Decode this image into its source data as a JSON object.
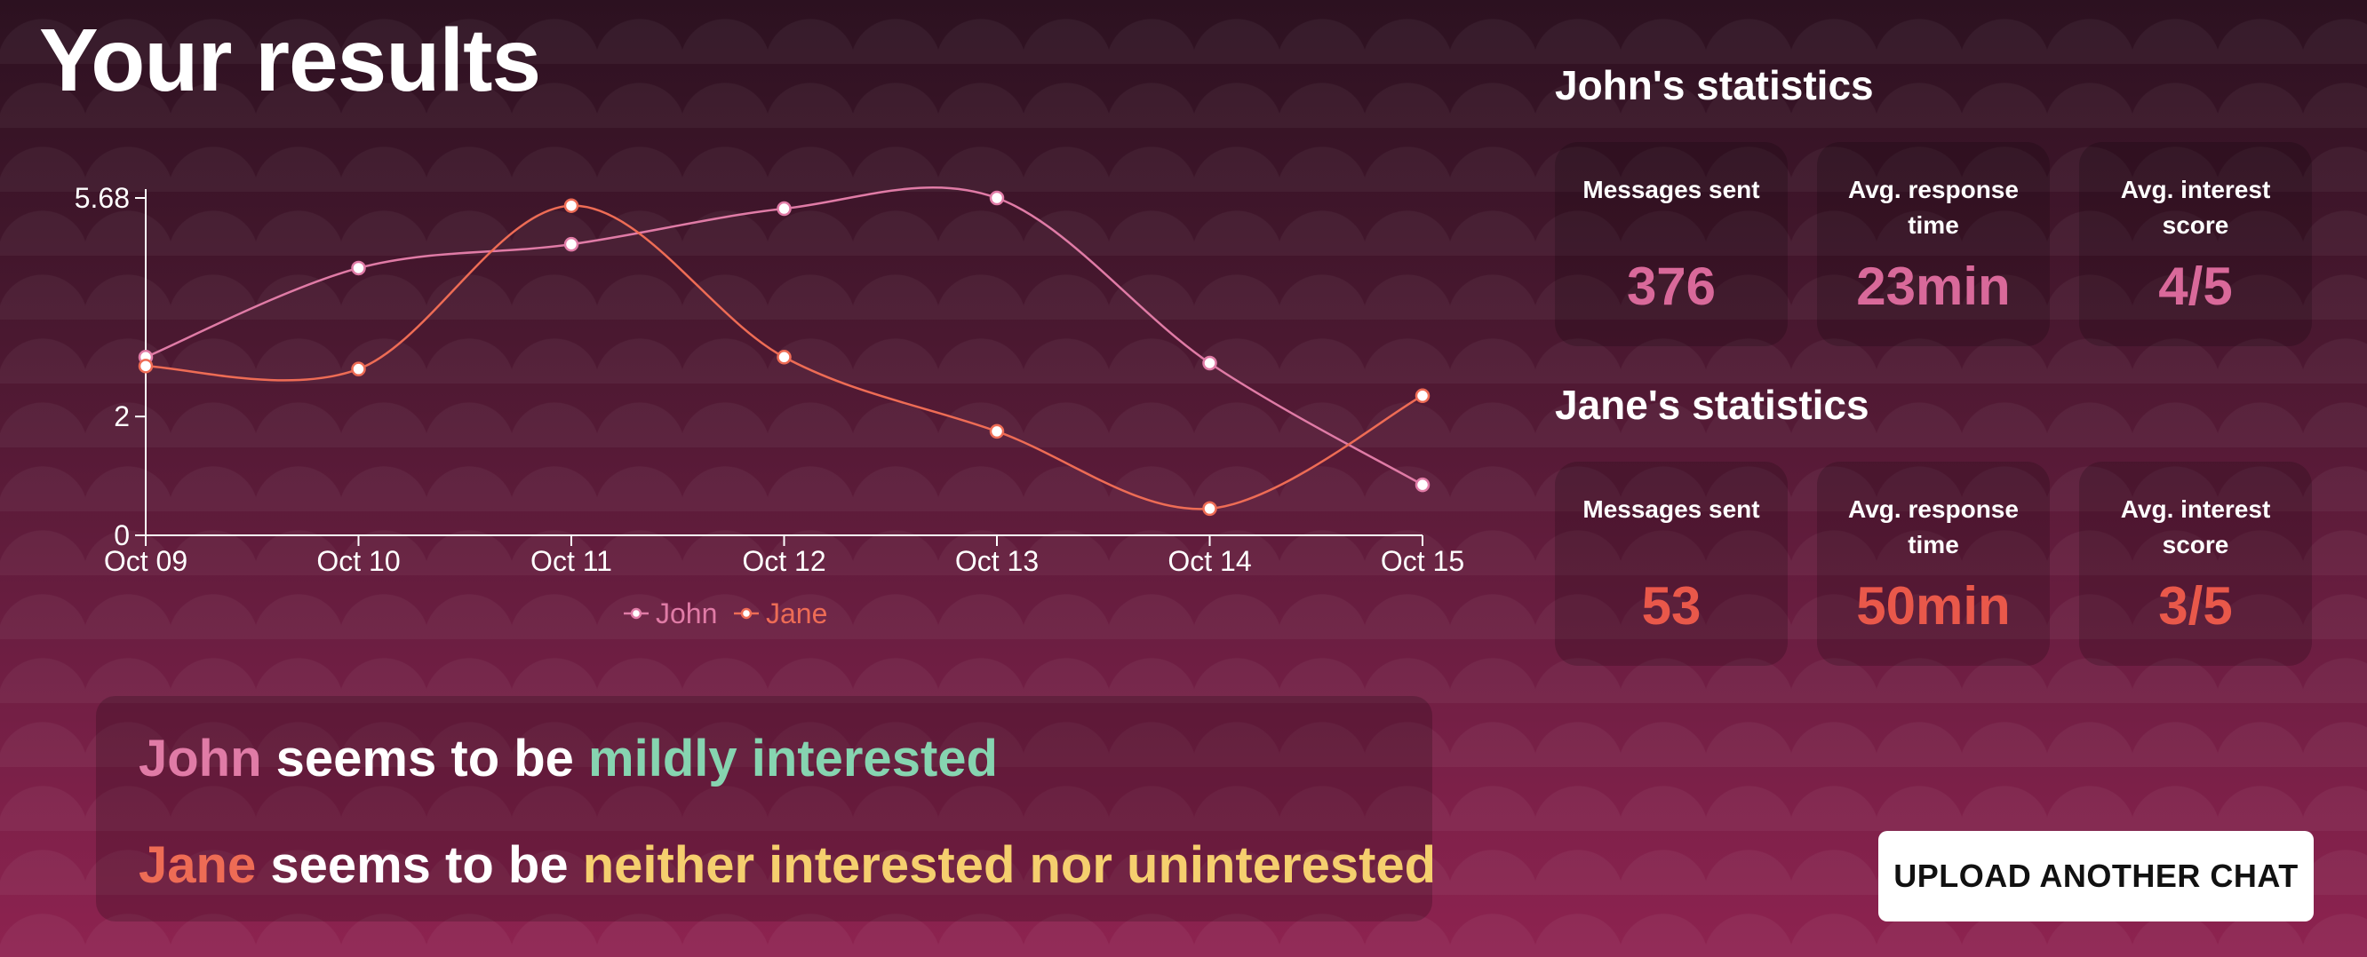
{
  "page": {
    "title": "Your results"
  },
  "chart_data": {
    "type": "line",
    "categories": [
      "Oct 09",
      "Oct 10",
      "Oct 11",
      "Oct 12",
      "Oct 13",
      "Oct 14",
      "Oct 15"
    ],
    "ylim": [
      0,
      5.68
    ],
    "yticks": [
      "5.68",
      "2",
      "0"
    ],
    "series": [
      {
        "name": "John",
        "color": "#e07ba6",
        "values": [
          3.0,
          4.5,
          4.9,
          5.5,
          5.68,
          2.9,
          0.85
        ]
      },
      {
        "name": "Jane",
        "color": "#ee6c55",
        "values": [
          2.85,
          2.8,
          5.55,
          3.0,
          1.75,
          0.45,
          2.35
        ]
      }
    ],
    "legend_position": "bottom-center",
    "grid": false
  },
  "interest": {
    "john": {
      "name": "John",
      "name_color": "#e07ba6",
      "middle": " seems to be ",
      "verdict": "mildly interested",
      "verdict_color": "#86d4b0"
    },
    "jane": {
      "name": "Jane",
      "name_color": "#ee6c55",
      "middle": " seems to be ",
      "verdict": "neither interested nor uninterested",
      "verdict_color": "#f5cf6e"
    }
  },
  "john_stats": {
    "heading": "John's statistics",
    "value_color": "#d9699a",
    "cards": [
      {
        "label": "Messages sent",
        "value": "376"
      },
      {
        "label": "Avg. response time",
        "value": "23min"
      },
      {
        "label": "Avg. interest score",
        "value": "4/5"
      }
    ]
  },
  "jane_stats": {
    "heading": "Jane's statistics",
    "value_color": "#e9584a",
    "cards": [
      {
        "label": "Messages sent",
        "value": "53"
      },
      {
        "label": "Avg. response time",
        "value": "50min"
      },
      {
        "label": "Avg. interest score",
        "value": "3/5"
      }
    ]
  },
  "actions": {
    "upload_label": "UPLOAD ANOTHER CHAT"
  }
}
